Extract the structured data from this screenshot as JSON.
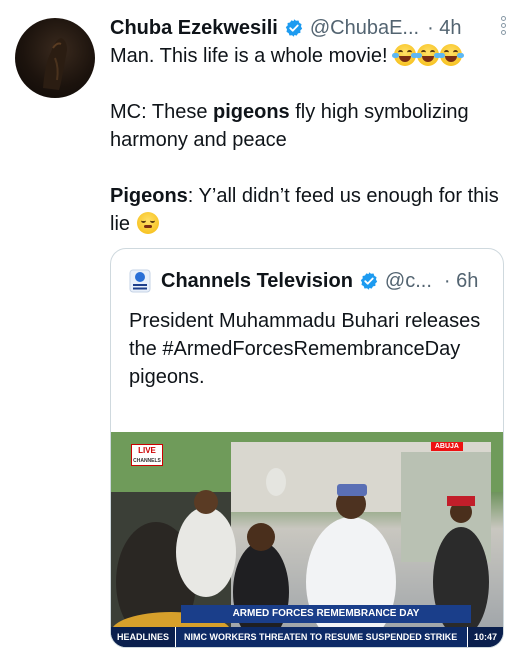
{
  "tweet": {
    "author_name": "Chuba Ezekwesili",
    "author_handle": "@ChubaE...",
    "timestamp": "· 4h",
    "line1_text": "Man. This life is a whole movie!",
    "line1_emoji": "face-with-tears-of-joy x3",
    "line2_prefix": "MC: These ",
    "line2_bold": "pigeons",
    "line2_suffix": " fly high symbolizing harmony and peace",
    "line3_bold": "Pigeons",
    "line3_text": ": Y’all didn’t feed us enough for this lie",
    "line3_emoji": "face-with-steam-from-nose"
  },
  "quote": {
    "author_name": "Channels Television",
    "author_handle": "@c...",
    "timestamp": "· 6h",
    "text": "President Muhammadu Buhari releases the #ArmedForcesRemembranceDay pigeons.",
    "media": {
      "live_label": "LIVE",
      "channel_label": "CHANNELS",
      "location_tag": "ABUJA",
      "lower_third": "ARMED FORCES REMEMBRANCE DAY",
      "ticker_tag": "HEADLINES",
      "ticker_text": "NIMC WORKERS THREATEN TO RESUME SUSPENDED STRIKE",
      "ticker_time": "10:47"
    }
  },
  "colors": {
    "verified_blue": "#1d9bf0",
    "secondary_text": "#536471",
    "border": "#cfd9de"
  }
}
